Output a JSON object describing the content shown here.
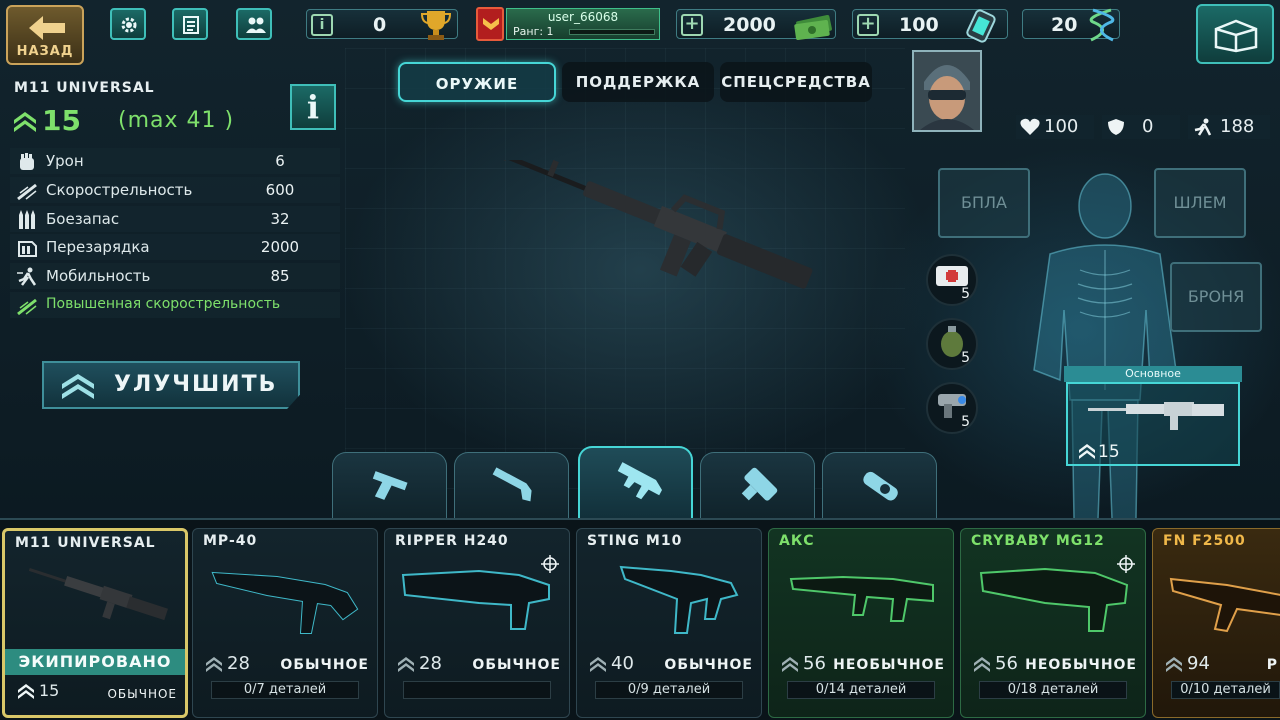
{
  "topbar": {
    "back_label": "НАЗАД",
    "trophy_value": "0",
    "user_name": "user_66068",
    "rank_label": "Ранг: 1",
    "cash_value": "2000",
    "energy_value": "100",
    "dna_value": "20"
  },
  "weapon": {
    "name": "M11 UNIVERSAL",
    "level": "15",
    "max_level": "(max 41 )",
    "info_label": "i",
    "stats": [
      {
        "icon": "fist-icon",
        "label": "Урон",
        "value": "6"
      },
      {
        "icon": "bullets-speed-icon",
        "label": "Скорострельность",
        "value": "600"
      },
      {
        "icon": "ammo-icon",
        "label": "Боезапас",
        "value": "32"
      },
      {
        "icon": "reload-icon",
        "label": "Перезарядка",
        "value": "2000"
      },
      {
        "icon": "running-icon",
        "label": "Мобильность",
        "value": "85"
      }
    ],
    "perk": "Повышенная скорострельность",
    "upgrade_label": "УЛУЧШИТЬ"
  },
  "center_tabs": [
    {
      "label": "ОРУЖИЕ",
      "active": true
    },
    {
      "label": "ПОДДЕРЖКА",
      "active": false
    },
    {
      "label": "СПЕЦСРЕДСТВА",
      "active": false
    }
  ],
  "category_tabs": [
    {
      "icon": "pistol-icon",
      "active": false
    },
    {
      "icon": "shotgun-icon",
      "active": false
    },
    {
      "icon": "assault-rifle-icon",
      "active": true
    },
    {
      "icon": "heavy-weapon-icon",
      "active": false
    },
    {
      "icon": "special-weapon-icon",
      "active": false
    }
  ],
  "character": {
    "health": "100",
    "armor": "0",
    "speed": "188",
    "slots": {
      "drone": "БПЛА",
      "helmet": "ШЛЕМ",
      "armor": "БРОНЯ"
    },
    "consumables": [
      {
        "icon": "medkit-icon",
        "count": "5"
      },
      {
        "icon": "grenade-icon",
        "count": "5"
      },
      {
        "icon": "blaster-icon",
        "count": "5"
      }
    ],
    "primary_label": "Основное",
    "primary_level": "15"
  },
  "cards": [
    {
      "name": "M11 UNIVERSAL",
      "equipped_label": "ЭКИПИРОВАНО",
      "level": "15",
      "rarity": "ОБЫЧНОЕ",
      "selected": true,
      "tier": "common"
    },
    {
      "name": "MP-40",
      "level": "28",
      "rarity": "ОБЫЧНОЕ",
      "parts": "0/7 деталей",
      "tier": "common"
    },
    {
      "name": "RIPPER H240",
      "level": "28",
      "rarity": "ОБЫЧНОЕ",
      "parts": "",
      "tier": "common",
      "target": true
    },
    {
      "name": "STING M10",
      "level": "40",
      "rarity": "ОБЫЧНОЕ",
      "parts": "0/9 деталей",
      "tier": "common"
    },
    {
      "name": "АКС",
      "level": "56",
      "rarity": "НЕОБЫЧНОЕ",
      "parts": "0/14 деталей",
      "tier": "uncommon"
    },
    {
      "name": "CRYBABY MG12",
      "level": "56",
      "rarity": "НЕОБЫЧНОЕ",
      "parts": "0/18 деталей",
      "tier": "uncommon",
      "target": true
    },
    {
      "name": "FN F2500",
      "level": "94",
      "rarity": "Р",
      "parts": "0/10 деталей",
      "tier": "rare"
    }
  ],
  "colors": {
    "accent": "#46d6d6",
    "green": "#7ee06b",
    "gold": "#f0b84a",
    "selected": "#d9c768"
  }
}
